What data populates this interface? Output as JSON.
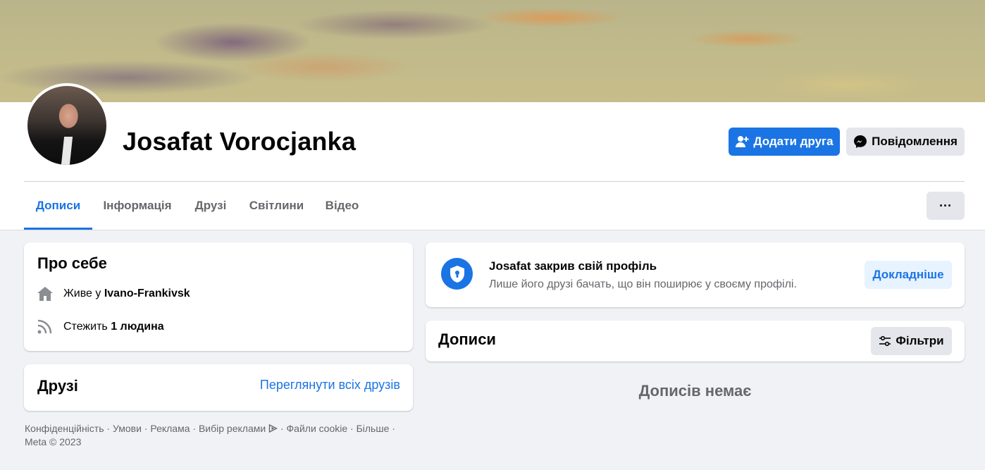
{
  "profile": {
    "name": "Josafat Vorocjanka",
    "add_friend_label": "Додати друга",
    "message_label": "Повідомлення",
    "more_label": "···"
  },
  "tabs": [
    {
      "label": "Дописи",
      "active": true
    },
    {
      "label": "Інформація",
      "active": false
    },
    {
      "label": "Друзі",
      "active": false
    },
    {
      "label": "Світлини",
      "active": false
    },
    {
      "label": "Відео",
      "active": false
    }
  ],
  "about": {
    "title": "Про себе",
    "lives_prefix": "Живе у",
    "lives_city": "Ivano-Frankivsk",
    "follows_prefix": "Стежить",
    "follows_count": "1 людина"
  },
  "friends": {
    "title": "Друзі",
    "see_all": "Переглянути всіх друзів"
  },
  "locked": {
    "title": "Josafat закрив свій профіль",
    "subtitle": "Лише його друзі бачать, що він поширює у своєму профілі.",
    "learn_more": "Докладніше"
  },
  "posts": {
    "title": "Дописи",
    "filters": "Фільтри",
    "empty": "Дописів немає"
  },
  "footer": {
    "links": [
      "Конфіденційність",
      "Умови",
      "Реклама",
      "Вибір реклами",
      "Файли cookie",
      "Більше"
    ],
    "copyright": "Meta © 2023"
  },
  "colors": {
    "accent": "#1b74e4",
    "background": "#f0f2f5",
    "secondary_text": "#65676b"
  }
}
